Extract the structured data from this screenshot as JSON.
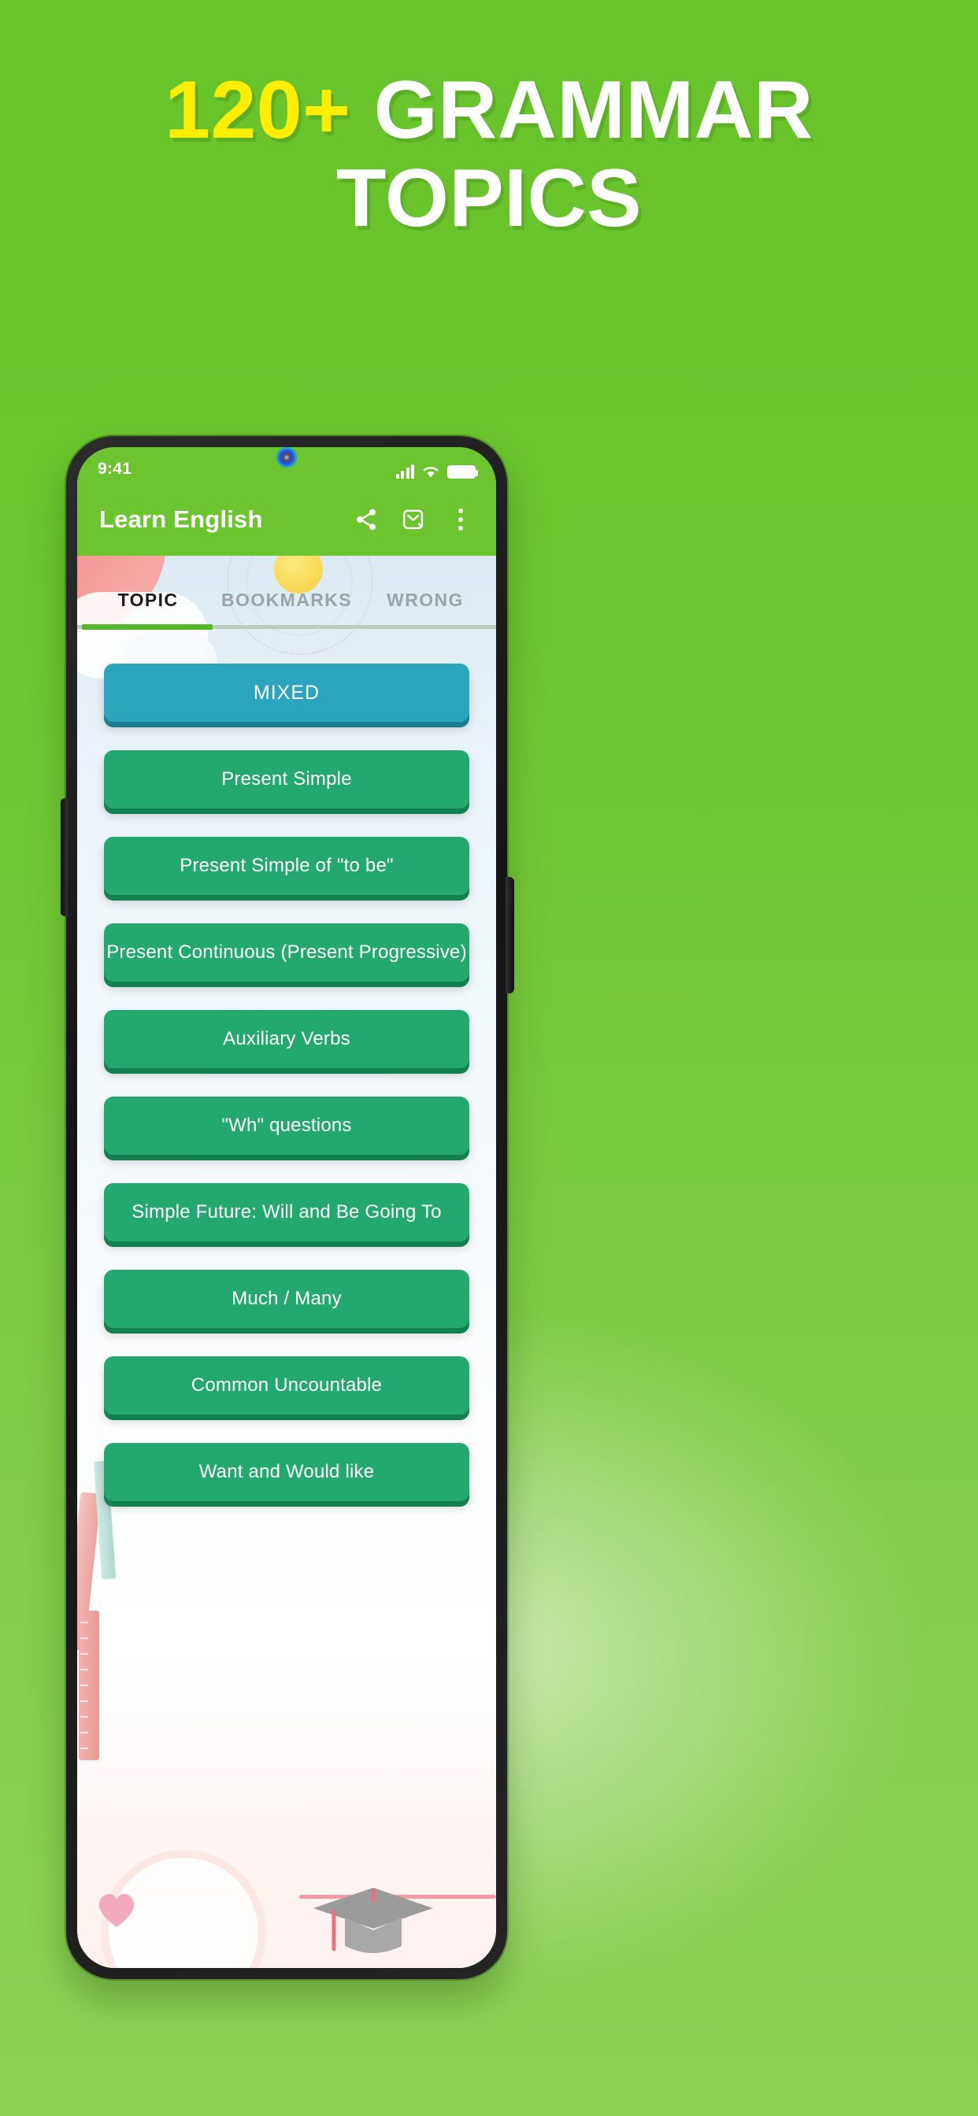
{
  "promo": {
    "headline_line1_highlight": "120+",
    "headline_line1_rest": "GRAMMAR",
    "headline_line2": "TOPICS",
    "bg_color": "#6cc52e",
    "highlight_color": "#ffee00"
  },
  "phone": {
    "status_bar": {
      "time": "9:41",
      "signal_icon": "cellular-signal-icon",
      "wifi_icon": "wifi-icon",
      "battery_icon": "battery-full-icon"
    },
    "app_bar": {
      "title": "Learn English",
      "actions": [
        {
          "name": "share-icon",
          "label": "Share"
        },
        {
          "name": "mail-check-icon",
          "label": "Feedback"
        },
        {
          "name": "overflow-menu-icon",
          "label": "More options"
        }
      ]
    },
    "tabs": {
      "items": [
        {
          "label": "TOPIC",
          "active": true
        },
        {
          "label": "BOOKMARKS",
          "active": false
        },
        {
          "label": "WRONG",
          "active": false
        }
      ],
      "active_index": 0,
      "indicator_color": "#55b62a"
    },
    "topics": {
      "accent_mixed": "#2aa5bd",
      "accent_green": "#23a96f",
      "items": [
        {
          "label": "MIXED",
          "style": "mixed"
        },
        {
          "label": "Present Simple",
          "style": "green"
        },
        {
          "label": "Present Simple of \"to be\"",
          "style": "green"
        },
        {
          "label": "Present Continuous (Present Progressive)",
          "style": "green"
        },
        {
          "label": "Auxiliary Verbs",
          "style": "green"
        },
        {
          "label": "\"Wh\" questions",
          "style": "green"
        },
        {
          "label": "Simple Future: Will and Be Going To",
          "style": "green"
        },
        {
          "label": "Much / Many",
          "style": "green"
        },
        {
          "label": "Common Uncountable",
          "style": "green"
        },
        {
          "label": "Want and Would like",
          "style": "green"
        }
      ]
    }
  }
}
